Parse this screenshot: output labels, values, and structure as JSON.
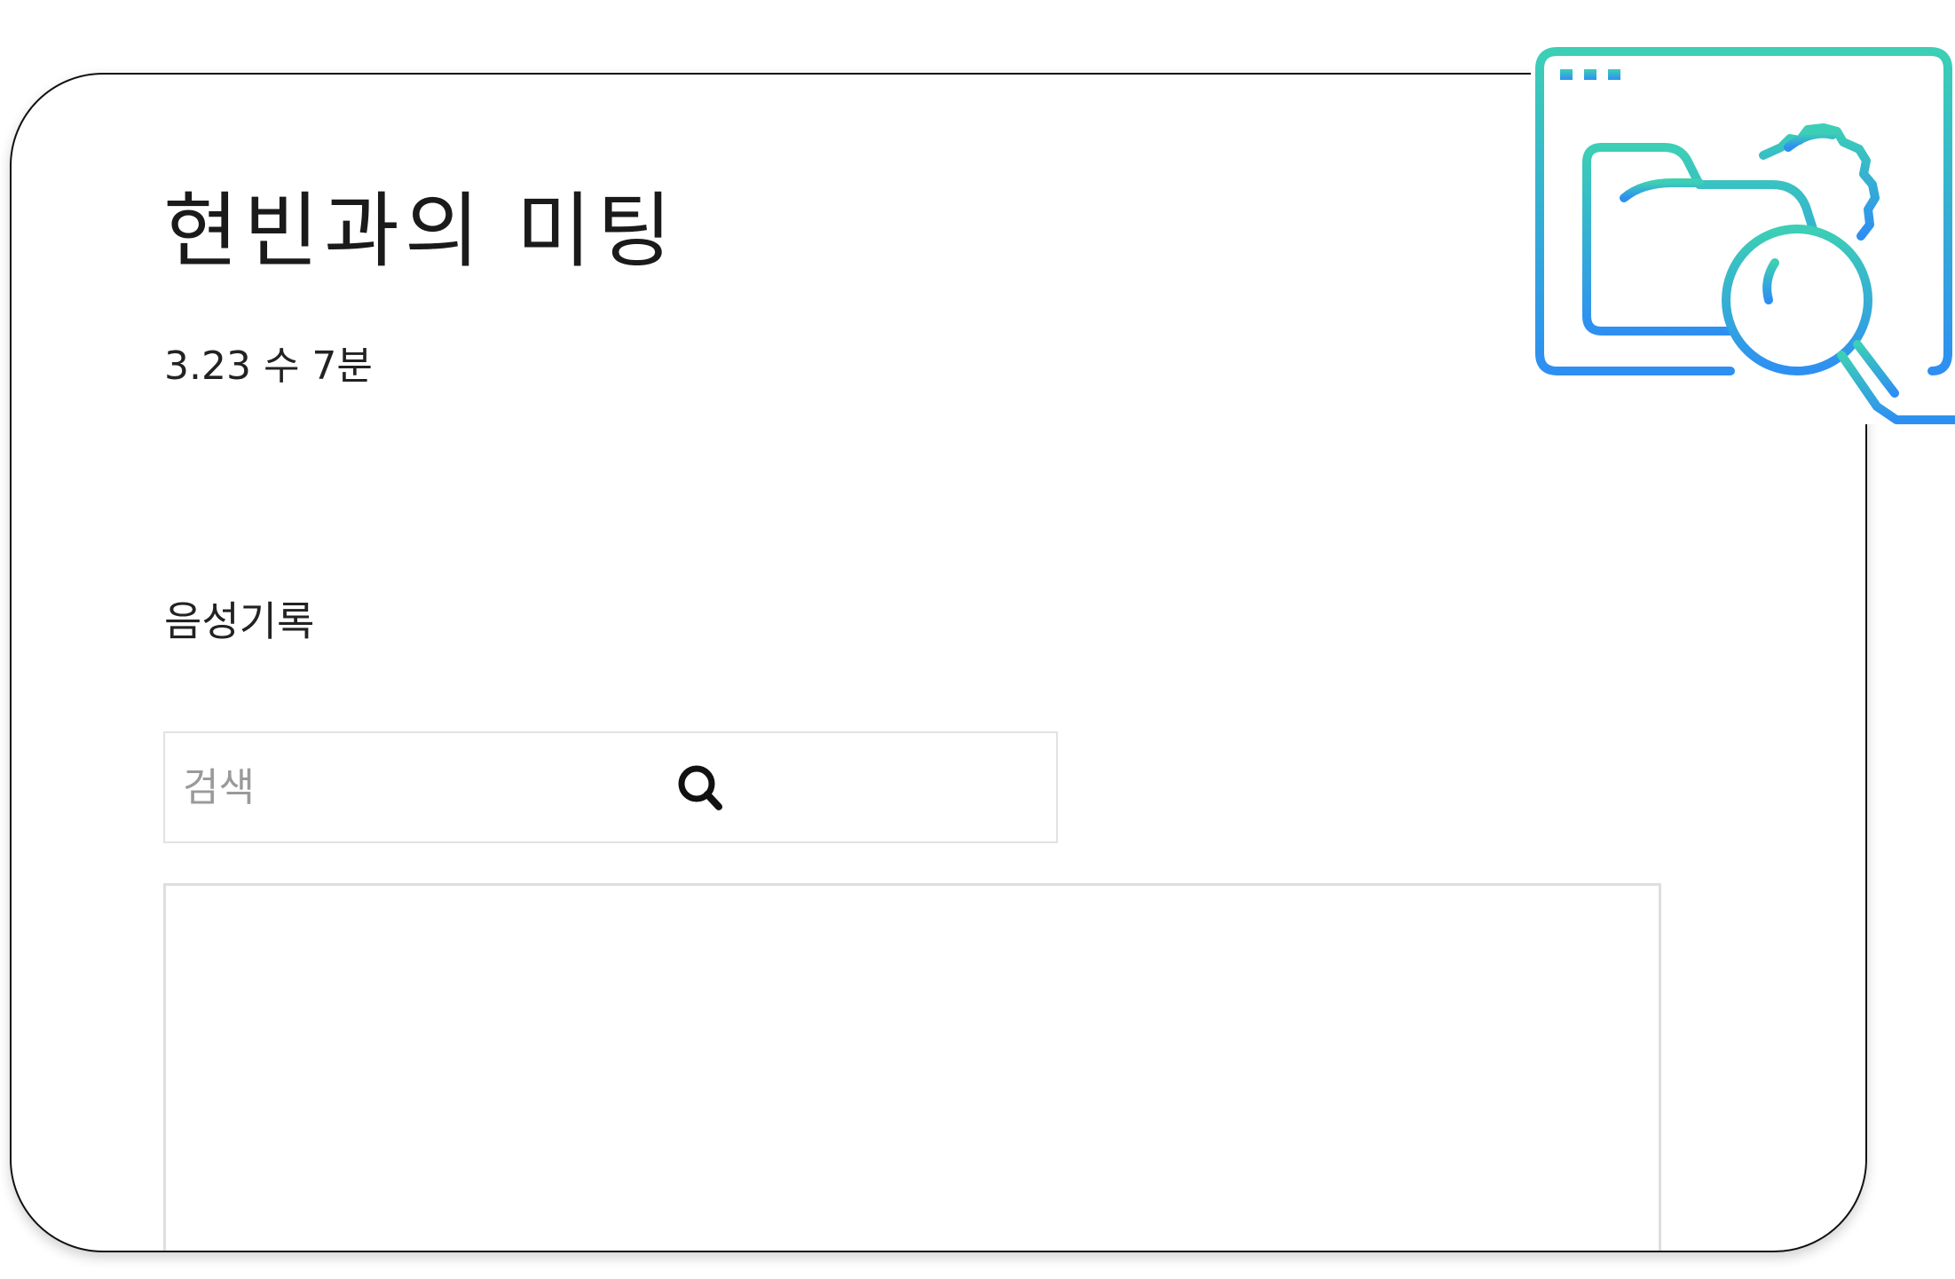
{
  "meeting": {
    "title": "현빈과의 미팅",
    "meta": "3.23 수 7분"
  },
  "transcript": {
    "section_label": "음성기록",
    "search": {
      "placeholder": "검색",
      "value": "",
      "button_icon": "search-icon"
    },
    "results": []
  },
  "logo": {
    "icon": "browser-folder-gear-magnifier-icon",
    "gradient_start": "#3ccfb5",
    "gradient_end": "#2e8ff2"
  },
  "colors": {
    "text_primary": "#1a1a1a",
    "placeholder": "#9a9a9a",
    "border": "#e2e2e2",
    "card_outline": "#111111"
  }
}
